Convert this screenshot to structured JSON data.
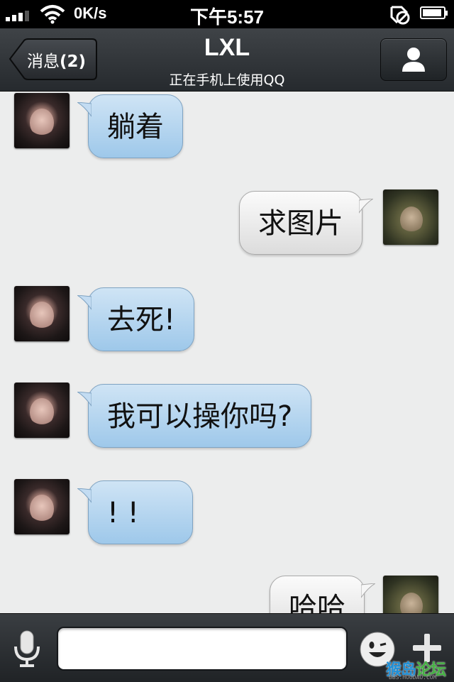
{
  "status_bar": {
    "speed": "0K/s",
    "time": "下午5:57"
  },
  "nav": {
    "back_label": "消息",
    "back_count": "(2)",
    "title": "LXL",
    "subtitle": "正在手机上使用QQ"
  },
  "messages": [
    {
      "side": "in",
      "text": "躺着"
    },
    {
      "side": "out",
      "text": "求图片"
    },
    {
      "side": "in",
      "text": "去死!"
    },
    {
      "side": "in",
      "text": "我可以操你吗?"
    },
    {
      "side": "in",
      "text": "! !"
    },
    {
      "side": "out",
      "text": "哈哈"
    }
  ],
  "input_bar": {
    "input_value": ""
  },
  "watermark": {
    "brand_a": "猴岛",
    "brand_b": "论坛",
    "url": "BBS.HOUDAO.COM"
  },
  "colors": {
    "incoming_bubble": "#a9cfee",
    "outgoing_bubble": "#f0f0f0",
    "nav_bar": "#2f3337"
  }
}
